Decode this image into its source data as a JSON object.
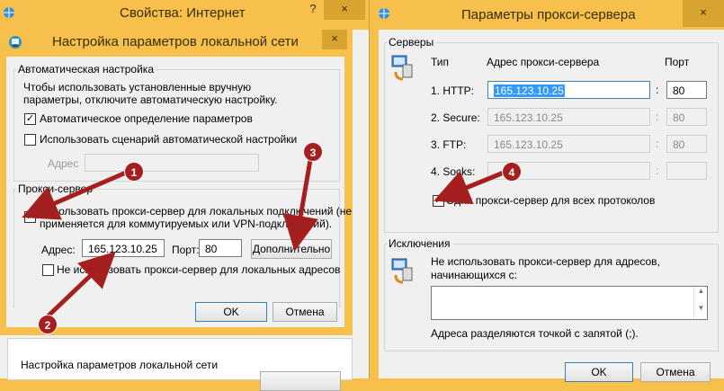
{
  "inet_window": {
    "title": "Свойства: Интернет",
    "help": "?",
    "close": "×",
    "lan_group_label": "Настройка параметров локальной сети"
  },
  "lan_dialog": {
    "title": "Настройка параметров локальной сети",
    "close": "×",
    "auto_group": {
      "label": "Автоматическая настройка",
      "description": "Чтобы использовать установленные вручную параметры, отключите автоматическую настройку.",
      "auto_detect": {
        "label": "Автоматическое определение параметров",
        "checked": true
      },
      "use_script": {
        "label": "Использовать сценарий автоматической настройки",
        "checked": false
      },
      "address_label": "Адрес",
      "address_value": ""
    },
    "proxy_group": {
      "label": "Прокси-сервер",
      "use_proxy_line1": "Использовать прокси-сервер для локальных подключений (не",
      "use_proxy_line2": "применяется для коммутируемых или VPN-подключений).",
      "use_proxy_checked": true,
      "address_label": "Адрес:",
      "address_value": "165.123.10.25",
      "port_label": "Порт:",
      "port_value": "80",
      "advanced_button": "Дополнительно",
      "bypass_local": {
        "label": "Не использовать прокси-сервер для локальных адресов",
        "checked": false
      }
    },
    "ok_button": "OK",
    "cancel_button": "Отмена"
  },
  "proxy_window": {
    "title": "Параметры прокси-сервера",
    "close": "×",
    "servers_group": {
      "label": "Серверы",
      "col_type": "Тип",
      "col_address": "Адрес прокси-сервера",
      "col_port": "Порт",
      "rows": [
        {
          "type": "1. HTTP:",
          "address": "165.123.10.25",
          "port": "80",
          "enabled": true
        },
        {
          "type": "2. Secure:",
          "address": "165.123.10.25",
          "port": "80",
          "enabled": false
        },
        {
          "type": "3. FTP:",
          "address": "165.123.10.25",
          "port": "80",
          "enabled": false
        },
        {
          "type": "4. Socks:",
          "address": "",
          "port": "",
          "enabled": false
        }
      ],
      "separator": ":",
      "same_proxy": {
        "label": "Один прокси-сервер для всех протоколов",
        "checked": true
      }
    },
    "exceptions_group": {
      "label": "Исключения",
      "description_line1": "Не использовать прокси-сервер для адресов,",
      "description_line2": "начинающихся с:",
      "value": "",
      "hint": "Адреса разделяются точкой с запятой (;)."
    },
    "ok_button": "OK",
    "cancel_button": "Отмена"
  },
  "annotations": {
    "color": "#a51f1f",
    "markers": [
      "1",
      "2",
      "3",
      "4"
    ]
  },
  "colors": {
    "titlebar": "#f6c04b",
    "selection": "#3399ff",
    "client": "#f0f0f0"
  }
}
